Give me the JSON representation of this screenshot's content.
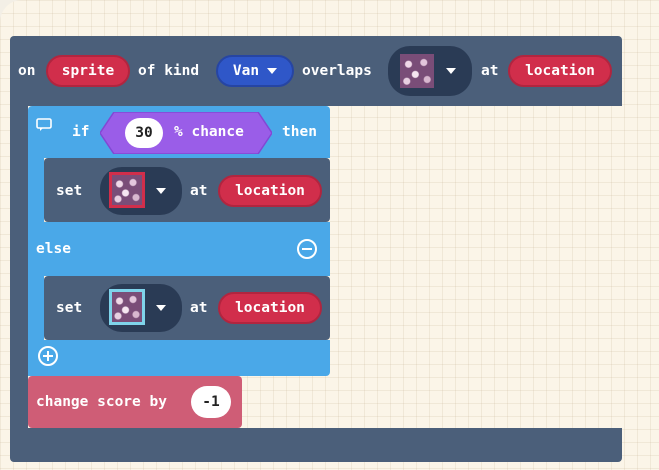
{
  "event_block": {
    "on_label": "on",
    "sprite_label": "sprite",
    "of_kind_label": "of kind",
    "kind_value": "Van",
    "overlaps_label": "overlaps",
    "at_label": "at",
    "location_label": "location"
  },
  "if_block": {
    "if_label": "if",
    "chance_value": "30",
    "chance_label": "% chance",
    "then_label": "then",
    "else_label": "else"
  },
  "set_block_1": {
    "set_label": "set",
    "at_label": "at",
    "location_label": "location"
  },
  "set_block_2": {
    "set_label": "set",
    "at_label": "at",
    "location_label": "location"
  },
  "score_block": {
    "label": "change score by",
    "value": "-1"
  },
  "colors": {
    "event_block": "#4b5f7a",
    "event_dark": "#3f5069",
    "logic_block": "#4aa8e8",
    "logic_dark": "#3f93cf",
    "chance_block": "#9a5de8",
    "scene_block": "#4b5f7a",
    "location_pill": "#d12e4b",
    "enum_pill": "#2f57c8",
    "info_block": "#cf5d76",
    "canvas": "#fbf5e8"
  },
  "icons": {
    "comment": "comment-icon",
    "remove_else": "minus-circle-icon",
    "add_else": "plus-circle-icon",
    "dropdown": "chevron-down-icon",
    "tile": "tile-image-icon"
  }
}
